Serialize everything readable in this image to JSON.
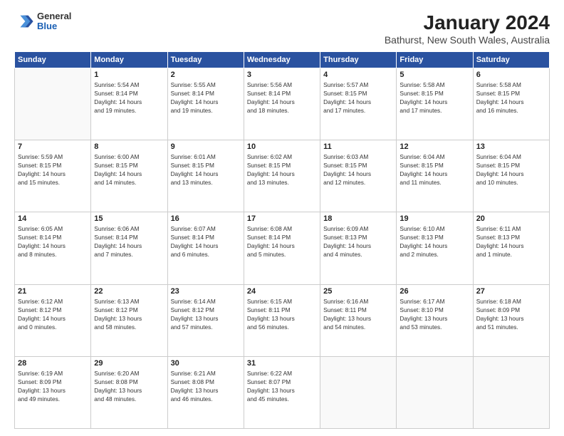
{
  "logo": {
    "general": "General",
    "blue": "Blue"
  },
  "title": "January 2024",
  "subtitle": "Bathurst, New South Wales, Australia",
  "header_days": [
    "Sunday",
    "Monday",
    "Tuesday",
    "Wednesday",
    "Thursday",
    "Friday",
    "Saturday"
  ],
  "weeks": [
    [
      {
        "day": "",
        "info": ""
      },
      {
        "day": "1",
        "info": "Sunrise: 5:54 AM\nSunset: 8:14 PM\nDaylight: 14 hours\nand 19 minutes."
      },
      {
        "day": "2",
        "info": "Sunrise: 5:55 AM\nSunset: 8:14 PM\nDaylight: 14 hours\nand 19 minutes."
      },
      {
        "day": "3",
        "info": "Sunrise: 5:56 AM\nSunset: 8:14 PM\nDaylight: 14 hours\nand 18 minutes."
      },
      {
        "day": "4",
        "info": "Sunrise: 5:57 AM\nSunset: 8:15 PM\nDaylight: 14 hours\nand 17 minutes."
      },
      {
        "day": "5",
        "info": "Sunrise: 5:58 AM\nSunset: 8:15 PM\nDaylight: 14 hours\nand 17 minutes."
      },
      {
        "day": "6",
        "info": "Sunrise: 5:58 AM\nSunset: 8:15 PM\nDaylight: 14 hours\nand 16 minutes."
      }
    ],
    [
      {
        "day": "7",
        "info": "Sunrise: 5:59 AM\nSunset: 8:15 PM\nDaylight: 14 hours\nand 15 minutes."
      },
      {
        "day": "8",
        "info": "Sunrise: 6:00 AM\nSunset: 8:15 PM\nDaylight: 14 hours\nand 14 minutes."
      },
      {
        "day": "9",
        "info": "Sunrise: 6:01 AM\nSunset: 8:15 PM\nDaylight: 14 hours\nand 13 minutes."
      },
      {
        "day": "10",
        "info": "Sunrise: 6:02 AM\nSunset: 8:15 PM\nDaylight: 14 hours\nand 13 minutes."
      },
      {
        "day": "11",
        "info": "Sunrise: 6:03 AM\nSunset: 8:15 PM\nDaylight: 14 hours\nand 12 minutes."
      },
      {
        "day": "12",
        "info": "Sunrise: 6:04 AM\nSunset: 8:15 PM\nDaylight: 14 hours\nand 11 minutes."
      },
      {
        "day": "13",
        "info": "Sunrise: 6:04 AM\nSunset: 8:15 PM\nDaylight: 14 hours\nand 10 minutes."
      }
    ],
    [
      {
        "day": "14",
        "info": "Sunrise: 6:05 AM\nSunset: 8:14 PM\nDaylight: 14 hours\nand 8 minutes."
      },
      {
        "day": "15",
        "info": "Sunrise: 6:06 AM\nSunset: 8:14 PM\nDaylight: 14 hours\nand 7 minutes."
      },
      {
        "day": "16",
        "info": "Sunrise: 6:07 AM\nSunset: 8:14 PM\nDaylight: 14 hours\nand 6 minutes."
      },
      {
        "day": "17",
        "info": "Sunrise: 6:08 AM\nSunset: 8:14 PM\nDaylight: 14 hours\nand 5 minutes."
      },
      {
        "day": "18",
        "info": "Sunrise: 6:09 AM\nSunset: 8:13 PM\nDaylight: 14 hours\nand 4 minutes."
      },
      {
        "day": "19",
        "info": "Sunrise: 6:10 AM\nSunset: 8:13 PM\nDaylight: 14 hours\nand 2 minutes."
      },
      {
        "day": "20",
        "info": "Sunrise: 6:11 AM\nSunset: 8:13 PM\nDaylight: 14 hours\nand 1 minute."
      }
    ],
    [
      {
        "day": "21",
        "info": "Sunrise: 6:12 AM\nSunset: 8:12 PM\nDaylight: 14 hours\nand 0 minutes."
      },
      {
        "day": "22",
        "info": "Sunrise: 6:13 AM\nSunset: 8:12 PM\nDaylight: 13 hours\nand 58 minutes."
      },
      {
        "day": "23",
        "info": "Sunrise: 6:14 AM\nSunset: 8:12 PM\nDaylight: 13 hours\nand 57 minutes."
      },
      {
        "day": "24",
        "info": "Sunrise: 6:15 AM\nSunset: 8:11 PM\nDaylight: 13 hours\nand 56 minutes."
      },
      {
        "day": "25",
        "info": "Sunrise: 6:16 AM\nSunset: 8:11 PM\nDaylight: 13 hours\nand 54 minutes."
      },
      {
        "day": "26",
        "info": "Sunrise: 6:17 AM\nSunset: 8:10 PM\nDaylight: 13 hours\nand 53 minutes."
      },
      {
        "day": "27",
        "info": "Sunrise: 6:18 AM\nSunset: 8:09 PM\nDaylight: 13 hours\nand 51 minutes."
      }
    ],
    [
      {
        "day": "28",
        "info": "Sunrise: 6:19 AM\nSunset: 8:09 PM\nDaylight: 13 hours\nand 49 minutes."
      },
      {
        "day": "29",
        "info": "Sunrise: 6:20 AM\nSunset: 8:08 PM\nDaylight: 13 hours\nand 48 minutes."
      },
      {
        "day": "30",
        "info": "Sunrise: 6:21 AM\nSunset: 8:08 PM\nDaylight: 13 hours\nand 46 minutes."
      },
      {
        "day": "31",
        "info": "Sunrise: 6:22 AM\nSunset: 8:07 PM\nDaylight: 13 hours\nand 45 minutes."
      },
      {
        "day": "",
        "info": ""
      },
      {
        "day": "",
        "info": ""
      },
      {
        "day": "",
        "info": ""
      }
    ]
  ]
}
